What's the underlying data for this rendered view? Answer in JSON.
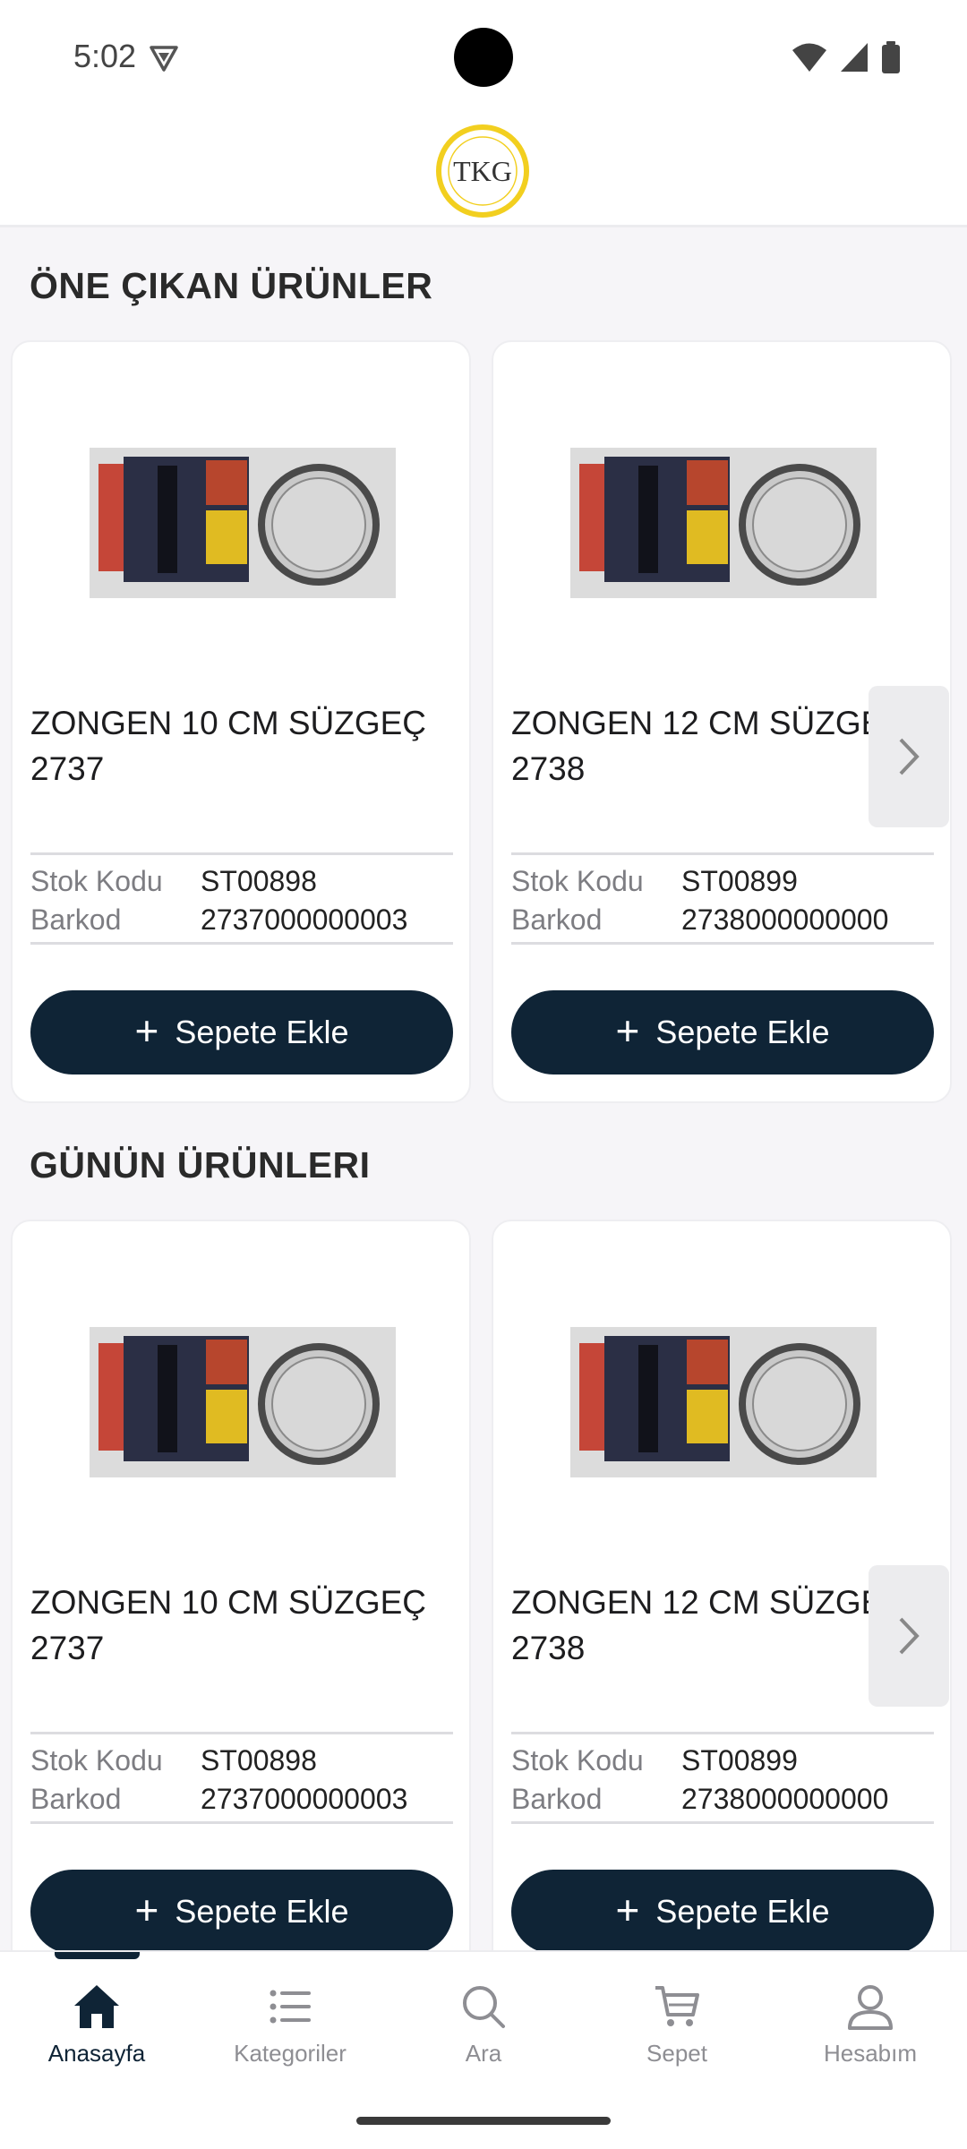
{
  "status_bar": {
    "time": "5:02"
  },
  "header": {
    "logo": "TKG"
  },
  "sections": [
    {
      "title": "ÖNE ÇIKAN ÜRÜNLER",
      "products": [
        {
          "name": "ZONGEN 10 CM SÜZGEÇ 2737",
          "stock_label": "Stok Kodu",
          "stock_code": "ST00898",
          "barcode_label": "Barkod",
          "barcode": "2737000000003",
          "button": "Sepete Ekle"
        },
        {
          "name": "ZONGEN 12 CM SÜZGEÇ 2738",
          "stock_label": "Stok Kodu",
          "stock_code": "ST00899",
          "barcode_label": "Barkod",
          "barcode": "2738000000000",
          "button": "Sepete Ekle"
        }
      ]
    },
    {
      "title": "GÜNÜN ÜRÜNLERI",
      "products": [
        {
          "name": "ZONGEN 10 CM SÜZGEÇ 2737",
          "stock_label": "Stok Kodu",
          "stock_code": "ST00898",
          "barcode_label": "Barkod",
          "barcode": "2737000000003",
          "button": "Sepete Ekle"
        },
        {
          "name": "ZONGEN 12 CM SÜZGEÇ 2738",
          "stock_label": "Stok Kodu",
          "stock_code": "ST00899",
          "barcode_label": "Barkod",
          "barcode": "2738000000000",
          "button": "Sepete Ekle"
        }
      ]
    }
  ],
  "bottom_nav": {
    "items": [
      {
        "label": "Anasayfa",
        "icon": "home-icon",
        "active": true
      },
      {
        "label": "Kategoriler",
        "icon": "list-icon",
        "active": false
      },
      {
        "label": "Ara",
        "icon": "search-icon",
        "active": false
      },
      {
        "label": "Sepet",
        "icon": "cart-icon",
        "active": false
      },
      {
        "label": "Hesabım",
        "icon": "user-icon",
        "active": false
      }
    ]
  },
  "colors": {
    "primary": "#0f2436",
    "background": "#f6f5f8",
    "muted": "#8e8e93",
    "logo_ring": "#f2cf1f"
  }
}
